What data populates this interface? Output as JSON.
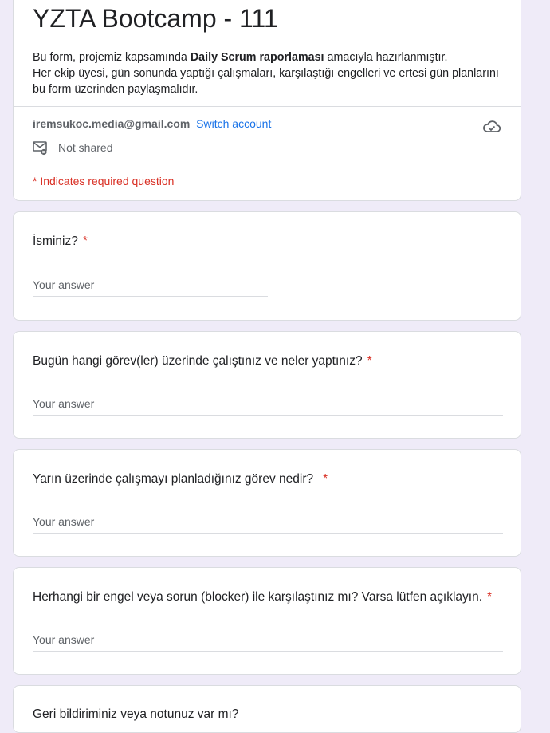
{
  "form": {
    "title": "YZTA Bootcamp - 111",
    "description_part1": "Bu form, projemiz kapsamında ",
    "description_bold": "Daily Scrum raporlaması",
    "description_part2": " amacıyla hazırlanmıştır.",
    "description_line2": "Her ekip üyesi, gün sonunda yaptığı çalışmaları, karşılaştığı engelleri ve ertesi gün planlarını bu form üzerinden paylaşmalıdır."
  },
  "account": {
    "email": "iremsukoc.media@gmail.com",
    "switch_label": "Switch account",
    "shared_status": "Not shared",
    "required_note": "* Indicates required question"
  },
  "questions": [
    {
      "label": "İsminiz?",
      "required_mark": "*",
      "placeholder": "Your answer"
    },
    {
      "label": "Bugün hangi görev(ler) üzerinde çalıştınız ve neler yaptınız?",
      "required_mark": "*",
      "placeholder": "Your answer"
    },
    {
      "label": "Yarın üzerinde çalışmayı planladığınız görev nedir?",
      "required_mark": "*",
      "placeholder": "Your answer"
    },
    {
      "label": "Herhangi bir engel veya sorun (blocker) ile karşılaştınız mı? Varsa lütfen açıklayın.",
      "required_mark": "*",
      "placeholder": "Your answer"
    },
    {
      "label": "Geri bildiriminiz veya notunuz var mı?"
    }
  ]
}
